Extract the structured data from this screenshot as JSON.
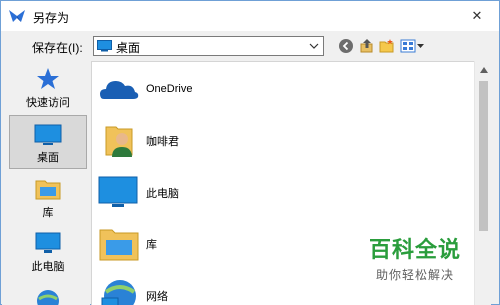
{
  "dialog": {
    "title": "另存为",
    "close_symbol": "✕"
  },
  "toolbar": {
    "save_in_label": "保存在(I):",
    "location_value": "桌面"
  },
  "sidebar": {
    "items": [
      {
        "label": "快速访问",
        "icon": "star-icon"
      },
      {
        "label": "桌面",
        "icon": "desktop-icon",
        "selected": true
      },
      {
        "label": "库",
        "icon": "library-icon"
      },
      {
        "label": "此电脑",
        "icon": "computer-icon"
      },
      {
        "label": "",
        "icon": "network-icon"
      }
    ]
  },
  "files": [
    {
      "name": "OneDrive",
      "icon": "onedrive-icon"
    },
    {
      "name": "咖啡君",
      "icon": "user-folder-icon"
    },
    {
      "name": "此电脑",
      "icon": "computer-icon"
    },
    {
      "name": "库",
      "icon": "library-icon"
    },
    {
      "name": "网络",
      "icon": "network-icon"
    }
  ],
  "watermark": {
    "title": "百科全说",
    "subtitle": "助你轻松解决"
  },
  "colors": {
    "accent": "#1e73be",
    "selection": "#d9d9d9",
    "watermark_green": "#2a9d3c"
  }
}
